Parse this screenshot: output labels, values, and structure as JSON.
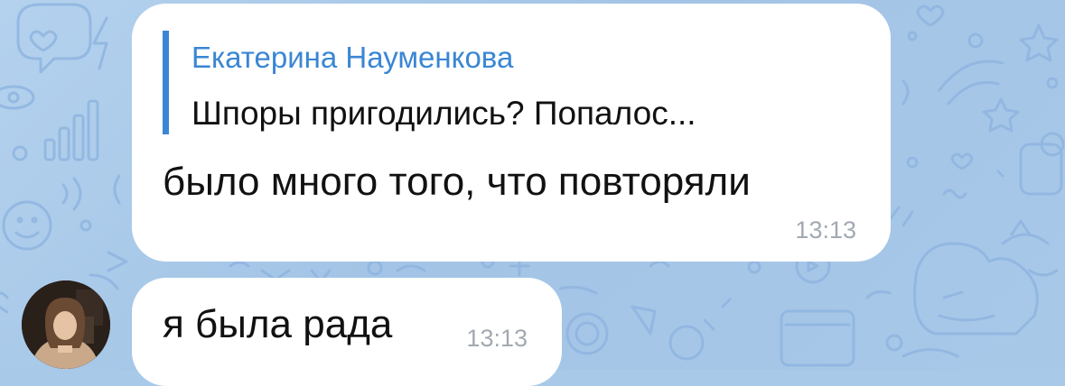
{
  "chat": {
    "background_color": "#a9c9e8",
    "accent_color": "#3a86d4",
    "messages": [
      {
        "reply": {
          "author": "Екатерина Науменкова",
          "text": "Шпоры пригодились? Попалос..."
        },
        "text": "было много того, что повторяли",
        "time": "13:13"
      },
      {
        "text": "я была рада",
        "time": "13:13"
      }
    ]
  }
}
